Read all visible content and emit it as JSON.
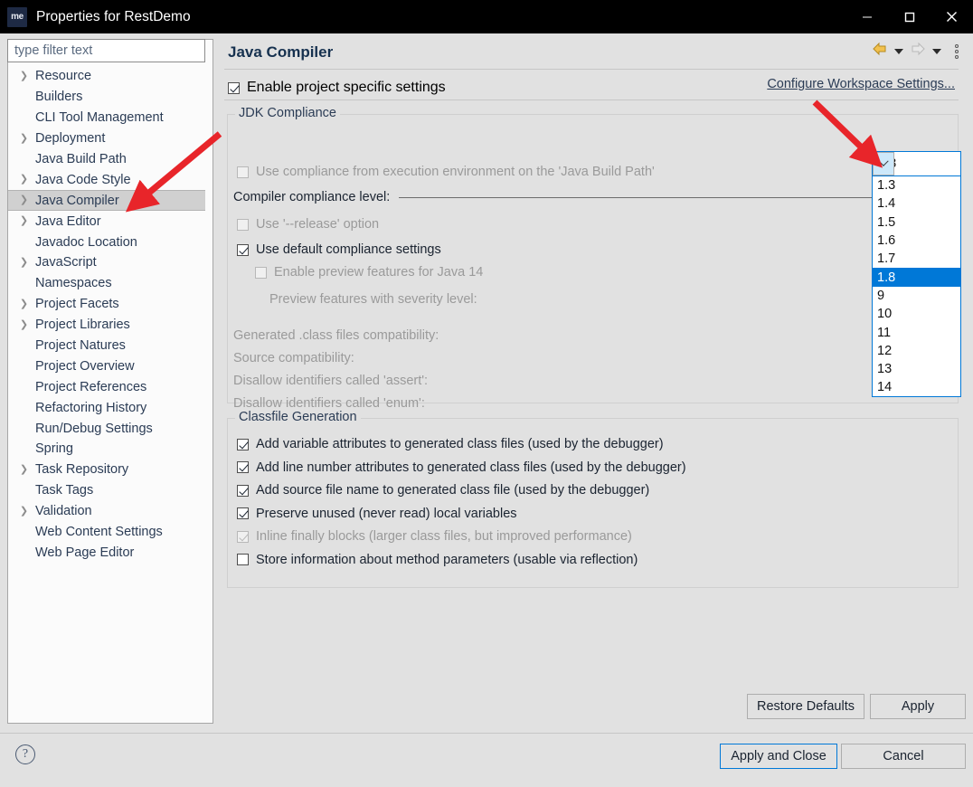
{
  "window": {
    "title": "Properties for RestDemo",
    "icon_label": "me",
    "controls": {
      "minimize": "minimize-icon",
      "maximize": "maximize-icon",
      "close": "close-icon"
    }
  },
  "sidebar": {
    "filter_placeholder": "type filter text",
    "filter_value": "",
    "items": [
      {
        "label": "Resource",
        "expandable": true,
        "selected": false
      },
      {
        "label": "Builders",
        "expandable": false,
        "selected": false
      },
      {
        "label": "CLI Tool Management",
        "expandable": false,
        "selected": false
      },
      {
        "label": "Deployment",
        "expandable": true,
        "selected": false
      },
      {
        "label": "Java Build Path",
        "expandable": false,
        "selected": false
      },
      {
        "label": "Java Code Style",
        "expandable": true,
        "selected": false
      },
      {
        "label": "Java Compiler",
        "expandable": true,
        "selected": true
      },
      {
        "label": "Java Editor",
        "expandable": true,
        "selected": false
      },
      {
        "label": "Javadoc Location",
        "expandable": false,
        "selected": false
      },
      {
        "label": "JavaScript",
        "expandable": true,
        "selected": false
      },
      {
        "label": "Namespaces",
        "expandable": false,
        "selected": false
      },
      {
        "label": "Project Facets",
        "expandable": true,
        "selected": false
      },
      {
        "label": "Project Libraries",
        "expandable": true,
        "selected": false
      },
      {
        "label": "Project Natures",
        "expandable": false,
        "selected": false
      },
      {
        "label": "Project Overview",
        "expandable": false,
        "selected": false
      },
      {
        "label": "Project References",
        "expandable": false,
        "selected": false
      },
      {
        "label": "Refactoring History",
        "expandable": false,
        "selected": false
      },
      {
        "label": "Run/Debug Settings",
        "expandable": false,
        "selected": false
      },
      {
        "label": "Spring",
        "expandable": false,
        "selected": false
      },
      {
        "label": "Task Repository",
        "expandable": true,
        "selected": false
      },
      {
        "label": "Task Tags",
        "expandable": false,
        "selected": false
      },
      {
        "label": "Validation",
        "expandable": true,
        "selected": false
      },
      {
        "label": "Web Content Settings",
        "expandable": false,
        "selected": false
      },
      {
        "label": "Web Page Editor",
        "expandable": false,
        "selected": false
      }
    ]
  },
  "main": {
    "page_title": "Java Compiler",
    "nav": {
      "back": "back-arrow-icon",
      "back_menu": "chevron-down-icon",
      "forward": "forward-arrow-icon",
      "forward_menu": "chevron-down-icon",
      "view_menu": "vertical-dots-icon"
    },
    "enable_project_specific": {
      "label": "Enable project specific settings",
      "checked": true
    },
    "configure_workspace_link": "Configure Workspace Settings...",
    "jdk_compliance": {
      "group_title": "JDK Compliance",
      "use_execution_env": {
        "label": "Use compliance from execution environment on the 'Java Build Path'",
        "checked": false,
        "enabled": false
      },
      "compliance_level_label": "Compiler compliance level:",
      "compliance_level_value": "1.8",
      "compliance_options": [
        "1.3",
        "1.4",
        "1.5",
        "1.6",
        "1.7",
        "1.8",
        "9",
        "10",
        "11",
        "12",
        "13",
        "14"
      ],
      "compliance_selected": "1.8",
      "use_release_option": {
        "label": "Use '--release' option",
        "checked": false,
        "enabled": false
      },
      "use_default_compliance": {
        "label": "Use default compliance settings",
        "checked": true,
        "enabled": true
      },
      "enable_preview": {
        "label": "Enable preview features for Java 14",
        "checked": false,
        "enabled": false
      },
      "disabled_rows": [
        "Preview features with severity level:",
        "Generated .class files compatibility:",
        "Source compatibility:",
        "Disallow identifiers called 'assert':",
        "Disallow identifiers called 'enum':"
      ]
    },
    "classfile_generation": {
      "group_title": "Classfile Generation",
      "options": [
        {
          "label": "Add variable attributes to generated class files (used by the debugger)",
          "checked": true,
          "enabled": true
        },
        {
          "label": "Add line number attributes to generated class files (used by the debugger)",
          "checked": true,
          "enabled": true
        },
        {
          "label": "Add source file name to generated class file (used by the debugger)",
          "checked": true,
          "enabled": true
        },
        {
          "label": "Preserve unused (never read) local variables",
          "checked": true,
          "enabled": true
        },
        {
          "label": "Inline finally blocks (larger class files, but improved performance)",
          "checked": true,
          "enabled": false
        },
        {
          "label": "Store information about method parameters (usable via reflection)",
          "checked": false,
          "enabled": true
        }
      ]
    }
  },
  "footer": {
    "restore_defaults": "Restore Defaults",
    "apply": "Apply",
    "apply_and_close": "Apply and Close",
    "cancel": "Cancel",
    "help": "?"
  },
  "colors": {
    "accent": "#0078d7",
    "dialog_bg": "#e1e1e1",
    "titlebar_bg": "#000000",
    "annotation_red": "#e8252a",
    "selection_blue": "#0078d7",
    "tree_selected": "#d0d0d0"
  }
}
